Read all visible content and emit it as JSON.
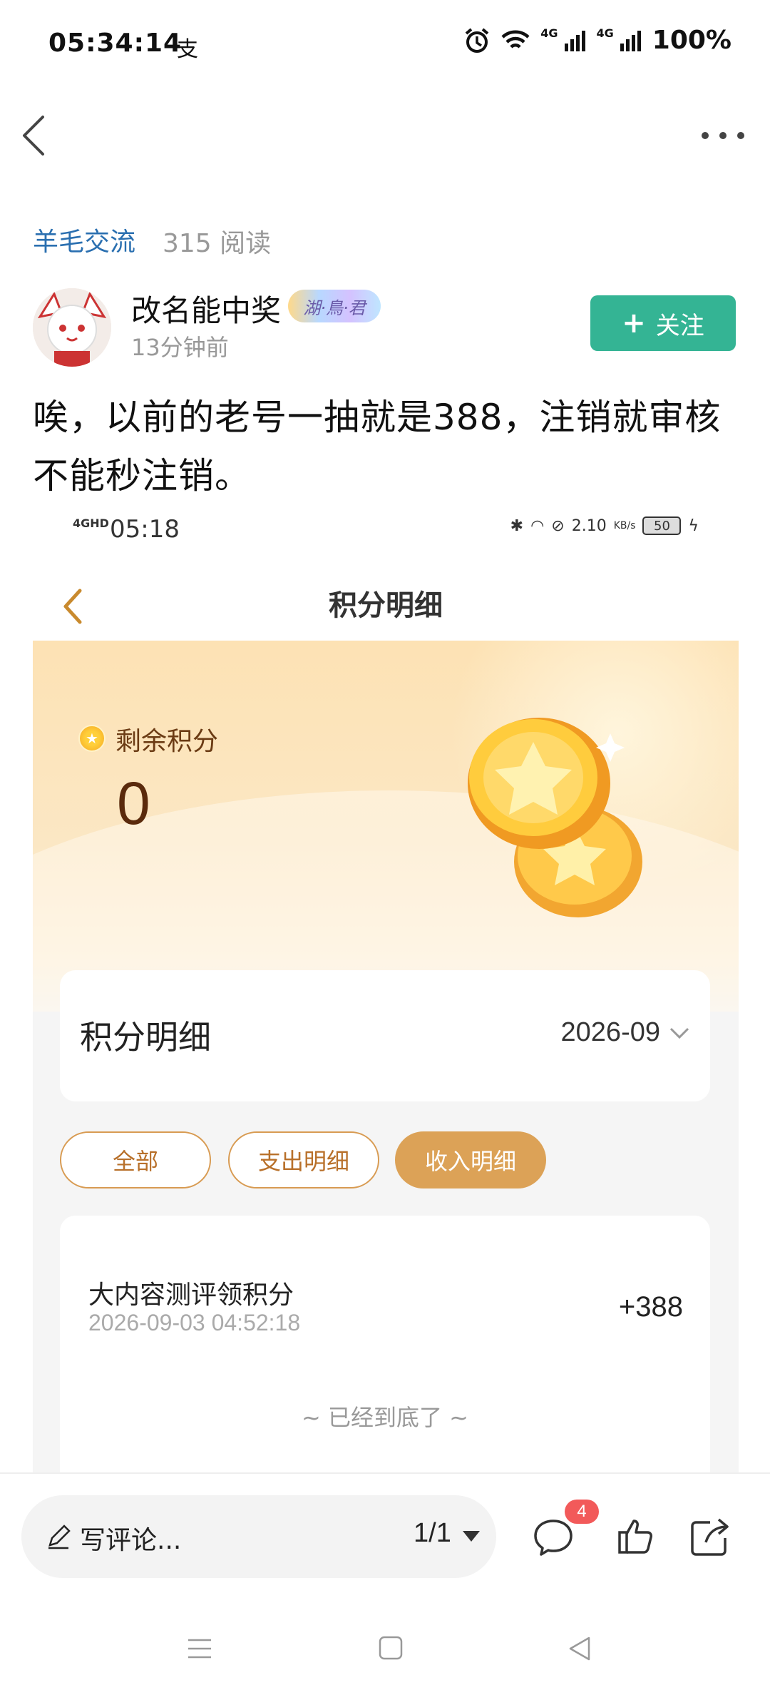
{
  "status_bar": {
    "time": "05:34:14",
    "notif": "支",
    "net_a": "4G",
    "net_b": "4G",
    "battery": "100%"
  },
  "post": {
    "forum": "羊毛交流",
    "reads": "315 阅读",
    "author": "改名能中奖",
    "author_badge": "湖·鳥·君",
    "time_ago": "13分钟前",
    "follow_label": "关注",
    "text": "唉，以前的老号一抽就是388，注销就审核不能秒注销。"
  },
  "embedded": {
    "status": {
      "net": "4GHD",
      "time": "05:18",
      "speed": "2.10",
      "speed_unit": "KB/s",
      "battery": "50"
    },
    "page_title": "积分明细",
    "balance_label": "剩余积分",
    "balance_value": "0",
    "detail_title": "积分明细",
    "month": "2026-09",
    "filters": [
      "全部",
      "支出明细",
      "收入明细"
    ],
    "active_filter": "收入明细",
    "records": [
      {
        "title": "大内容测评领积分",
        "date": "2026-09-03 04:52:18",
        "amount": "+388"
      }
    ],
    "end_note": "~ 已经到底了 ~"
  },
  "bottom_bar": {
    "comment_placeholder": "写评论...",
    "page_indicator": "1/1",
    "comment_count": "4"
  },
  "icons": [
    "back-icon",
    "more-icon",
    "comment-icon",
    "like-icon",
    "share-icon",
    "pencil-icon",
    "menu-icon",
    "home-icon",
    "nav-back-icon"
  ],
  "colors": {
    "accent_green": "#34b494",
    "forum_blue": "#2a6fb0",
    "gold": "#dca257",
    "badge_red": "#f25a5a"
  }
}
